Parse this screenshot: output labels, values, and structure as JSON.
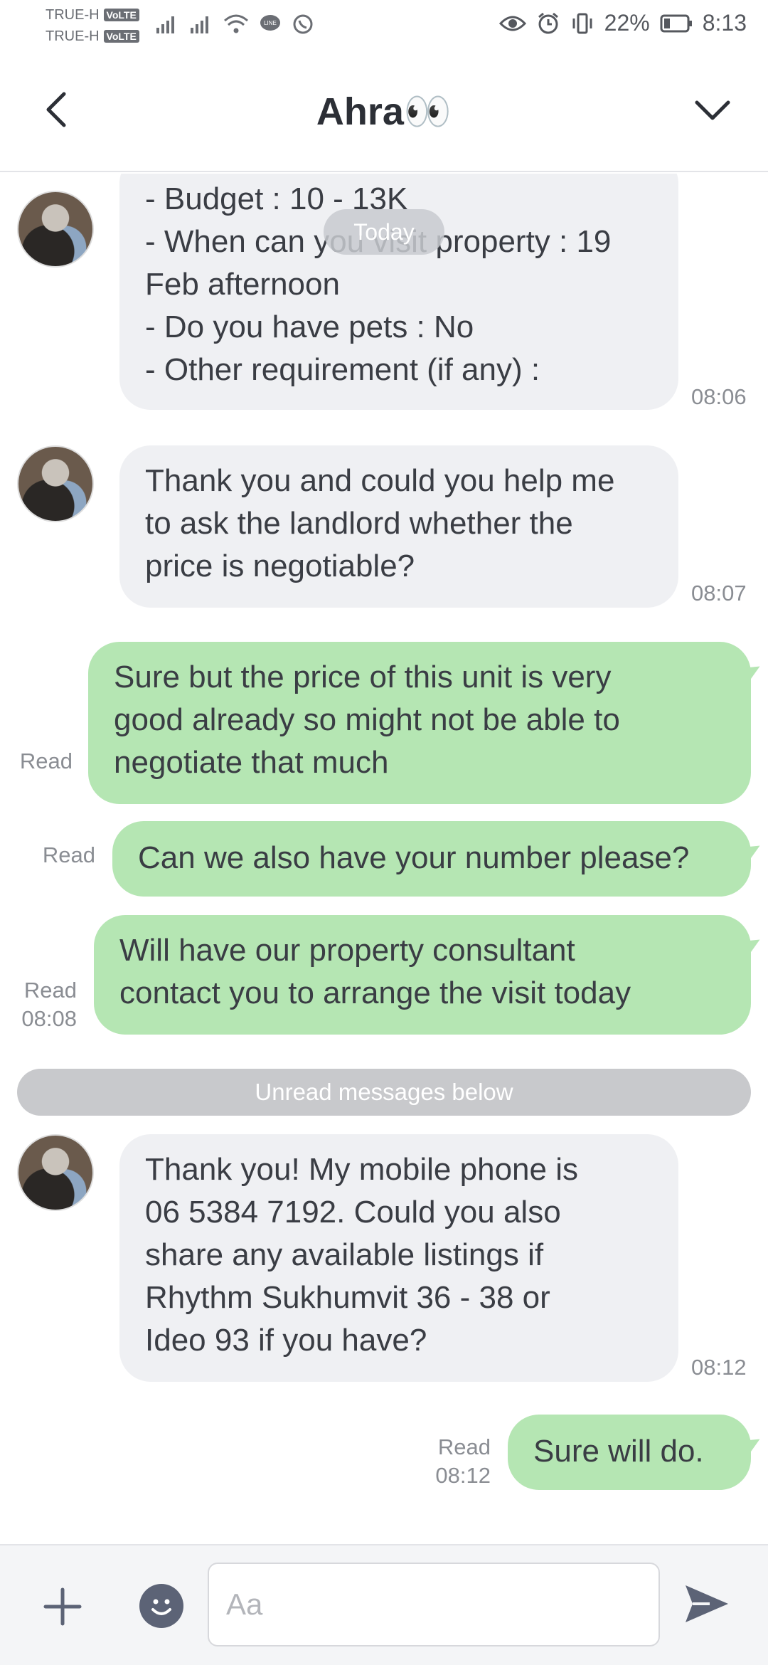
{
  "status_bar": {
    "carrier_1": "TRUE-H",
    "carrier_2": "TRUE-H",
    "volte_badge": "VoLTE",
    "battery_percent": "22%",
    "time": "8:13"
  },
  "header": {
    "title": "Ahra👀"
  },
  "chat": {
    "date_divider": "Today",
    "unread_divider": "Unread messages below",
    "messages": [
      {
        "direction": "incoming",
        "lines": [
          "- Budget : 10 - 13K",
          "- When can you visit property : 19",
          "Feb afternoon",
          "- Do you have pets : No",
          "- Other requirement (if any) :"
        ],
        "time": "08:06"
      },
      {
        "direction": "incoming",
        "lines": [
          "Thank you and could you help me",
          "to ask the landlord whether the",
          "price is negotiable?"
        ],
        "time": "08:07"
      },
      {
        "direction": "outgoing",
        "lines": [
          "Sure but the price of this unit is very",
          "good already so might not be able to",
          "negotiate that much"
        ],
        "status": "Read"
      },
      {
        "direction": "outgoing",
        "lines": [
          "Can we also have your number please?"
        ],
        "status": "Read"
      },
      {
        "direction": "outgoing",
        "lines": [
          "Will have our property consultant",
          "contact you to arrange the visit today"
        ],
        "status": "Read",
        "time": "08:08"
      },
      {
        "direction": "incoming",
        "lines": [
          "Thank you! My mobile phone is",
          "06 5384 7192. Could you also",
          "share any available listings if",
          "Rhythm Sukhumvit 36 - 38 or",
          "Ideo 93 if you have?"
        ],
        "time": "08:12"
      },
      {
        "direction": "outgoing",
        "lines": [
          "Sure will do."
        ],
        "status": "Read",
        "time": "08:12"
      }
    ]
  },
  "input": {
    "placeholder": "Aa"
  },
  "colors": {
    "incoming_bubble": "#eff0f3",
    "outgoing_bubble": "#b5e6b3",
    "icon_gray": "#5c6376"
  },
  "icons": {
    "back": "chevron-left-icon",
    "menu": "chevron-down-icon",
    "add": "plus-icon",
    "emoji": "smiley-icon",
    "send": "send-icon"
  }
}
